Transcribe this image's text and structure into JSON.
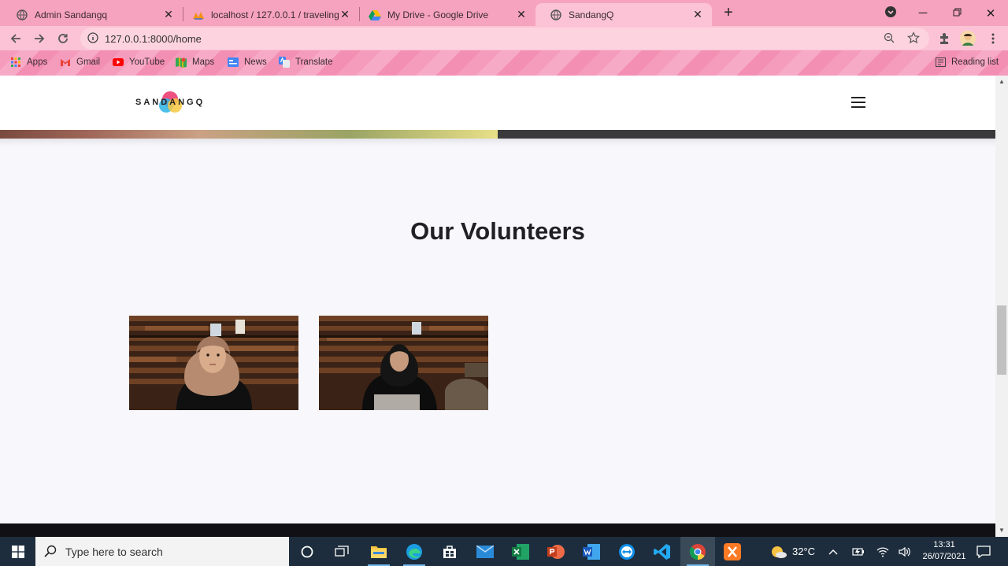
{
  "browser": {
    "tabs": [
      {
        "title": "Admin Sandangq",
        "icon": "globe-icon"
      },
      {
        "title": "localhost / 127.0.0.1 / travelingku",
        "icon": "phpmyadmin-icon"
      },
      {
        "title": "My Drive - Google Drive",
        "icon": "google-drive-icon"
      },
      {
        "title": "SandangQ",
        "icon": "globe-icon",
        "active": true
      }
    ],
    "url": "127.0.0.1:8000/home",
    "bookmarks": [
      {
        "label": "Apps",
        "icon": "apps-grid-icon"
      },
      {
        "label": "Gmail",
        "icon": "gmail-icon"
      },
      {
        "label": "YouTube",
        "icon": "youtube-icon"
      },
      {
        "label": "Maps",
        "icon": "maps-icon"
      },
      {
        "label": "News",
        "icon": "news-icon"
      },
      {
        "label": "Translate",
        "icon": "translate-icon"
      }
    ],
    "reading_list": "Reading list"
  },
  "site": {
    "logo_text": "SANDANGQ",
    "section_title": "Our Volunteers",
    "volunteers": [
      {
        "photo": "volunteer-photo-hijab-woman"
      },
      {
        "photo": "volunteer-photo-woman-laptop"
      }
    ]
  },
  "taskbar": {
    "search_placeholder": "Type here to search",
    "weather": "32°C",
    "time": "13:31",
    "date": "26/07/2021"
  },
  "colors": {
    "tab_strip": "#f6a3bf",
    "toolbar": "#fbc3d5",
    "page_bg": "#f8f8fc",
    "taskbar": "#1d2d3d"
  }
}
